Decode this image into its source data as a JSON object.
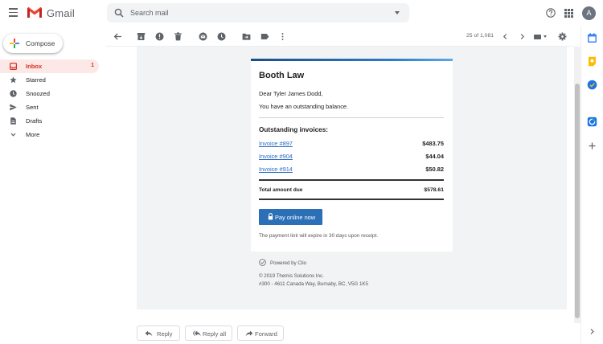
{
  "app": {
    "brand": "Gmail",
    "search_placeholder": "Search mail",
    "avatar_letter": "A"
  },
  "compose": {
    "label": "Compose"
  },
  "nav": {
    "items": [
      {
        "label": "Inbox",
        "count": "1",
        "icon": "inbox-icon",
        "active": true
      },
      {
        "label": "Starred",
        "icon": "star-icon"
      },
      {
        "label": "Snoozed",
        "icon": "clock-icon"
      },
      {
        "label": "Sent",
        "icon": "send-icon"
      },
      {
        "label": "Drafts",
        "icon": "draft-icon"
      },
      {
        "label": "More",
        "icon": "chevron-down-icon"
      }
    ]
  },
  "toolbar": {
    "pager": "25 of 1,081",
    "icons": [
      "back-arrow-icon",
      "archive-icon",
      "report-spam-icon",
      "delete-icon",
      "mark-unread-icon",
      "snooze-icon",
      "move-to-icon",
      "label-icon",
      "more-vert-icon",
      "prev-icon",
      "next-icon",
      "keyboard-icon",
      "settings-icon"
    ]
  },
  "email": {
    "firm": "Booth Law",
    "greeting": "Dear Tyler James Dodd,",
    "message": "You have an outstanding balance.",
    "invoices_heading": "Outstanding invoices:",
    "invoices": [
      {
        "label": "Invoice #897",
        "amount": "$483.75"
      },
      {
        "label": "Invoice #904",
        "amount": "$44.04"
      },
      {
        "label": "Invoice #914",
        "amount": "$50.82"
      }
    ],
    "total_label": "Total amount due",
    "total_amount": "$578.61",
    "pay_button": "Pay online now",
    "expire_note": "The payment link will expire in 30 days upon receipt.",
    "powered_by": "Powered by Clio",
    "copyright": "© 2019 Themis Solutions Inc.",
    "address": "#300 - 4611 Canada Way, Burnaby, BC, V5G 1K5"
  },
  "reply_bar": {
    "reply": "Reply",
    "reply_all": "Reply all",
    "forward": "Forward"
  },
  "colors": {
    "gmail_red": "#d93025",
    "pay_button_blue": "#2b6fb6",
    "link_blue": "#2a6cc2"
  }
}
